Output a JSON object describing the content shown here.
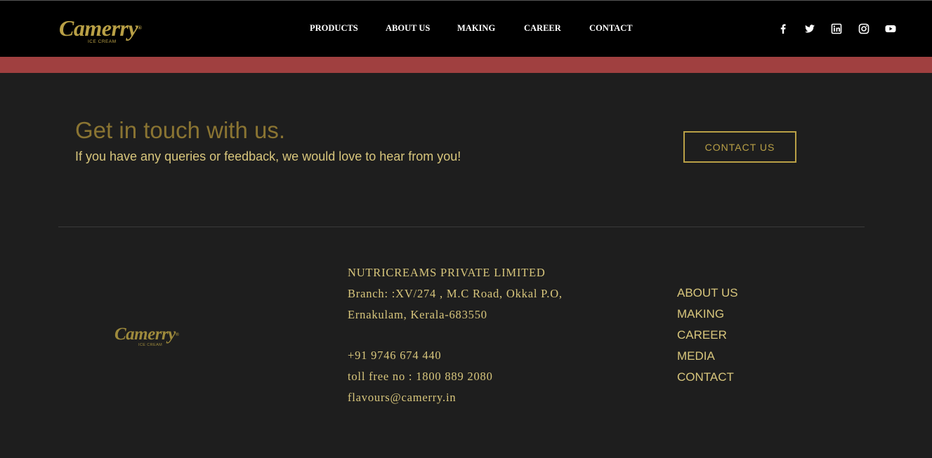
{
  "brand": {
    "name": "Camerry",
    "tagline": "ICE CREAM",
    "trademark": "®",
    "color": "#b9a046"
  },
  "nav": {
    "items": [
      "PRODUCTS",
      "ABOUT US",
      "MAKING",
      "CAREER",
      "CONTACT"
    ]
  },
  "social": [
    "facebook-icon",
    "twitter-icon",
    "linkedin-icon",
    "instagram-icon",
    "youtube-icon"
  ],
  "cta": {
    "title": "Get in touch with us.",
    "subtitle": "If you have any queries or feedback, we would love to hear from you!",
    "button_label": "CONTACT US"
  },
  "footer": {
    "company": "NUTRICREAMS PRIVATE LIMITED",
    "address_line1": "Branch: :XV/274 , M.C Road, Okkal P.O,",
    "address_line2": "Ernakulam, Kerala-683550",
    "phone": "+91 9746 674 440",
    "tollfree": "toll free no : 1800 889 2080",
    "email": "flavours@camerry.in",
    "links": [
      "ABOUT US",
      "MAKING",
      "CAREER",
      "MEDIA",
      "CONTACT"
    ]
  },
  "colors": {
    "header_bg": "#000000",
    "band": "#a04040",
    "page_bg": "#1e1e1e",
    "gold": "#d8c67c"
  }
}
